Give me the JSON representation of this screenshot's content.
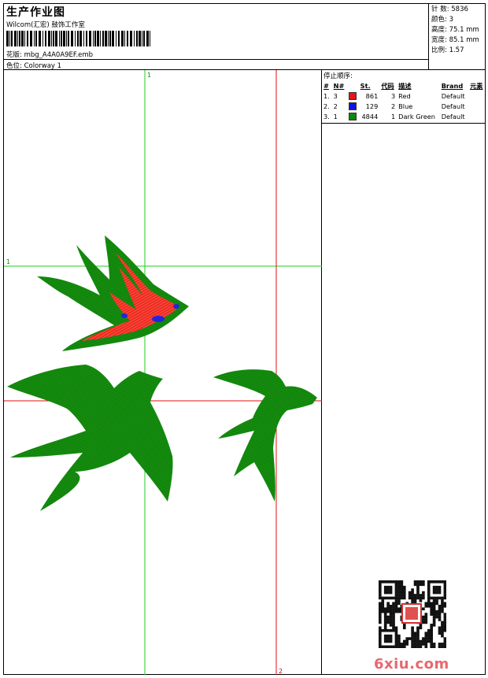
{
  "header": {
    "title": "生产作业图",
    "company": "Wilcom(汇宏) 鼓饰工作室",
    "design_label": "花版: mbg_A4A0A9EF.emb",
    "colorway_label": "色位: Colorway 1"
  },
  "stats": {
    "stitches": "针 数: 5836",
    "colors": "颜色: 3",
    "height": "高度: 75.1 mm",
    "width": "宽度: 85.1 mm",
    "ratio": "比例: 1.57"
  },
  "stop_sequence": {
    "title": "停止顺序:",
    "headers": [
      "#",
      "N#",
      "St.",
      "代码",
      "描述",
      "Brand",
      "元素"
    ],
    "rows": [
      {
        "idx": "1.",
        "n": "3",
        "st": "861",
        "code": "3",
        "desc": "Red",
        "brand": "Default",
        "color": "#e8141a"
      },
      {
        "idx": "2.",
        "n": "2",
        "st": "129",
        "code": "2",
        "desc": "Blue",
        "brand": "Default",
        "color": "#1212e0"
      },
      {
        "idx": "3.",
        "n": "1",
        "st": "4844",
        "code": "1",
        "desc": "Dark Green",
        "brand": "Default",
        "color": "#0a8a0a"
      }
    ]
  },
  "guides": {
    "label_top": "1",
    "label_left": "1",
    "label_right": "2",
    "label_bottom": "2"
  },
  "watermark": "6xiu.com",
  "colors": {
    "green": "#148c0e",
    "red": "#f02a20",
    "blue": "#2424e0",
    "guide_green": "#22cc22",
    "guide_red": "#e01010"
  }
}
